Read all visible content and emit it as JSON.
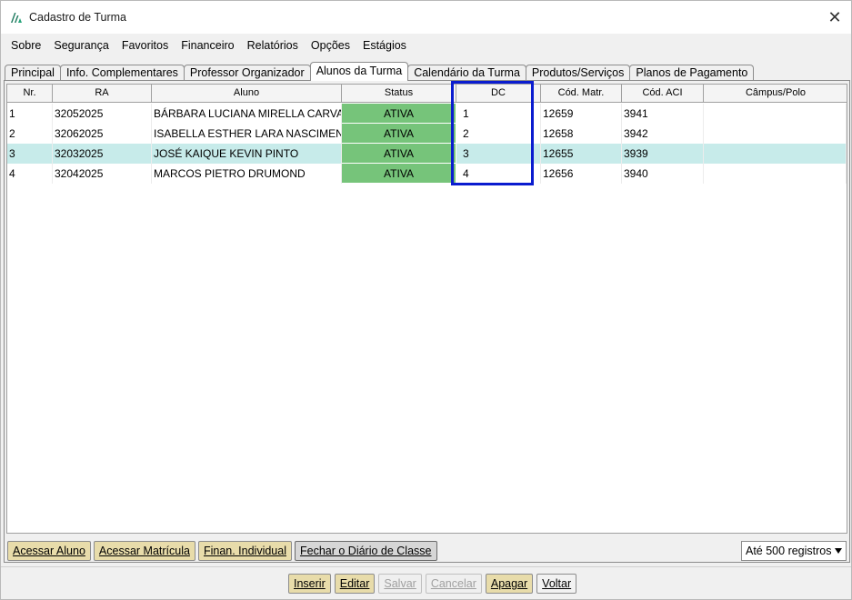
{
  "window": {
    "title": "Cadastro de Turma"
  },
  "menu": [
    "Sobre",
    "Segurança",
    "Favoritos",
    "Financeiro",
    "Relatórios",
    "Opções",
    "Estágios"
  ],
  "tabs": [
    "Principal",
    "Info. Complementares",
    "Professor Organizador",
    "Alunos da Turma",
    "Calendário da Turma",
    "Produtos/Serviços",
    "Planos de Pagamento"
  ],
  "active_tab": "Alunos da Turma",
  "grid": {
    "columns": [
      "Nr.",
      "RA",
      "Aluno",
      "Status",
      "DC",
      "Cód. Matr.",
      "Cód. ACI",
      "Câmpus/Polo"
    ],
    "rows": [
      {
        "nr": "1",
        "ra": "32052025",
        "aluno": "BÁRBARA LUCIANA MIRELLA CARVA...",
        "status": "ATIVA",
        "dc": "1",
        "matr": "12659",
        "aci": "3941",
        "campus": ""
      },
      {
        "nr": "2",
        "ra": "32062025",
        "aluno": "ISABELLA ESTHER LARA NASCIMENTO",
        "status": "ATIVA",
        "dc": "2",
        "matr": "12658",
        "aci": "3942",
        "campus": ""
      },
      {
        "nr": "3",
        "ra": "32032025",
        "aluno": "JOSÉ KAIQUE KEVIN PINTO",
        "status": "ATIVA",
        "dc": "3",
        "matr": "12655",
        "aci": "3939",
        "campus": ""
      },
      {
        "nr": "4",
        "ra": "32042025",
        "aluno": "MARCOS PIETRO DRUMOND",
        "status": "ATIVA",
        "dc": "4",
        "matr": "12656",
        "aci": "3940",
        "campus": ""
      }
    ],
    "selected_row": 3
  },
  "actions": {
    "acessar_aluno": "Acessar Aluno",
    "acessar_matricula": "Acessar Matrícula",
    "finan_individual": "Finan. Individual",
    "fechar_diario": "Fechar o Diário de Classe"
  },
  "records_select": "Até 500 registros",
  "footer": {
    "inserir": "Inserir",
    "editar": "Editar",
    "salvar": "Salvar",
    "cancelar": "Cancelar",
    "apagar": "Apagar",
    "voltar": "Voltar"
  },
  "colors": {
    "status_green": "#76c47a",
    "selected_row": "#c7ebea",
    "highlight_frame": "#0a1ccf",
    "button_tan": "#e8dcaa"
  }
}
